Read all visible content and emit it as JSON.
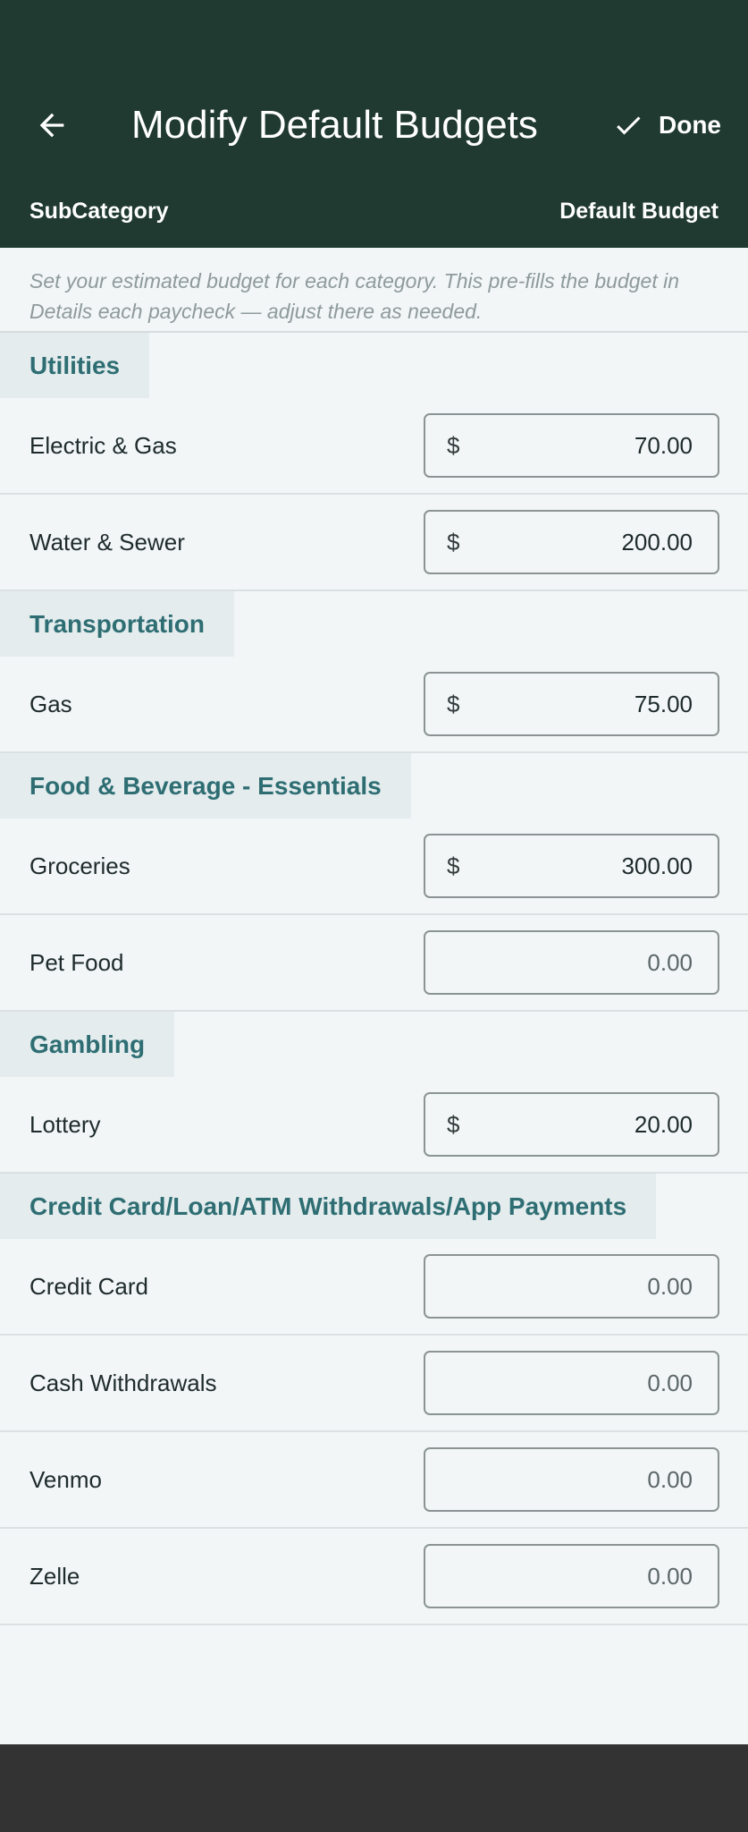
{
  "header": {
    "title": "Modify Default Budgets",
    "back_icon": "arrow-left-icon",
    "done_icon": "check-icon",
    "done_label": "Done",
    "col_left": "SubCategory",
    "col_right": "Default Budget",
    "background": "#203a31"
  },
  "help_text": "Set your estimated budget for each category. This pre-fills the budget in Details each paycheck — adjust there as needed.",
  "currency_symbol": "$",
  "sections": [
    {
      "name": "Utilities",
      "items": [
        {
          "label": "Electric & Gas",
          "value": "70.00",
          "show_currency": true
        },
        {
          "label": "Water & Sewer",
          "value": "200.00",
          "show_currency": true
        }
      ]
    },
    {
      "name": "Transportation",
      "items": [
        {
          "label": "Gas",
          "value": "75.00",
          "show_currency": true
        }
      ]
    },
    {
      "name": "Food & Beverage - Essentials",
      "items": [
        {
          "label": "Groceries",
          "value": "300.00",
          "show_currency": true
        },
        {
          "label": "Pet Food",
          "value": "0.00",
          "show_currency": false
        }
      ]
    },
    {
      "name": "Gambling",
      "items": [
        {
          "label": "Lottery",
          "value": "20.00",
          "show_currency": true
        }
      ]
    },
    {
      "name": "Credit Card/Loan/ATM Withdrawals/App Payments",
      "items": [
        {
          "label": "Credit Card",
          "value": "0.00",
          "show_currency": false
        },
        {
          "label": "Cash Withdrawals",
          "value": "0.00",
          "show_currency": false
        },
        {
          "label": "Venmo",
          "value": "0.00",
          "show_currency": false
        },
        {
          "label": "Zelle",
          "value": "0.00",
          "show_currency": false
        }
      ]
    }
  ],
  "colors": {
    "section_text": "#2e6e73",
    "section_bg": "#e4ecee",
    "page_bg": "#f2f6f7",
    "bottom_bar": "#333333"
  }
}
